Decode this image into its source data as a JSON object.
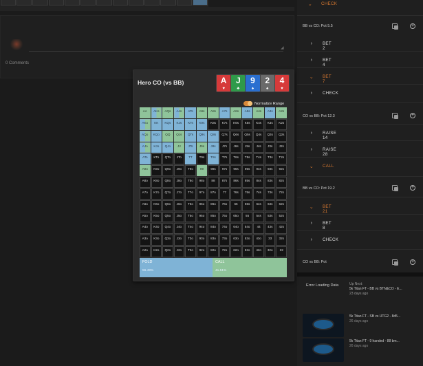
{
  "comments": {
    "count_label": "0 Comments"
  },
  "range": {
    "title": "Hero CO (vs BB)",
    "board": [
      {
        "rank": "A",
        "suit": "♥",
        "color": "#d63a3a"
      },
      {
        "rank": "J",
        "suit": "♣",
        "color": "#2f9a4a"
      },
      {
        "rank": "9",
        "suit": "♠",
        "color": "#2a6fd0"
      },
      {
        "rank": "2",
        "suit": "♠",
        "color": "#6a6a6a"
      },
      {
        "rank": "4",
        "suit": "♥",
        "color": "#d63a3a"
      }
    ],
    "normalize_label": "Normalize Range",
    "normalize_on": true,
    "legend_colors": {
      "fold": "#7fb3d6",
      "call": "#8fc49a"
    },
    "fold": {
      "label": "FOLD",
      "percent": "56.49%"
    },
    "call": {
      "label": "CALL",
      "percent": "41.51%"
    },
    "grid": [
      [
        "AA",
        "AKs",
        "AQs",
        "AJs",
        "ATs",
        "A9s",
        "A8s",
        "A7s",
        "A6s",
        "A5s",
        "A4s",
        "A3s",
        "A2s"
      ],
      [
        "AKo",
        "KK",
        "KQs",
        "KJs",
        "KTs",
        "K9s",
        "K8s",
        "K7s",
        "K6s",
        "K5s",
        "K4s",
        "K3s",
        "K2s"
      ],
      [
        "AQo",
        "KQo",
        "QQ",
        "QJs",
        "QTs",
        "Q9s",
        "Q8s",
        "Q7s",
        "Q6s",
        "Q5s",
        "Q4s",
        "Q3s",
        "Q2s"
      ],
      [
        "AJo",
        "KJo",
        "QJo",
        "JJ",
        "JTs",
        "J9s",
        "J8s",
        "J7s",
        "J6s",
        "J5s",
        "J4s",
        "J3s",
        "J2s"
      ],
      [
        "ATo",
        "KTo",
        "QTo",
        "JTo",
        "TT",
        "T9s",
        "T8s",
        "T7s",
        "T6s",
        "T5s",
        "T4s",
        "T3s",
        "T2s"
      ],
      [
        "A9o",
        "K9o",
        "Q9o",
        "J9o",
        "T9o",
        "99",
        "98s",
        "97s",
        "96s",
        "95s",
        "94s",
        "93s",
        "92s"
      ],
      [
        "A8o",
        "K8o",
        "Q8o",
        "J8o",
        "T8o",
        "98o",
        "88",
        "87s",
        "86s",
        "85s",
        "84s",
        "83s",
        "82s"
      ],
      [
        "A7o",
        "K7o",
        "Q7o",
        "J7o",
        "T7o",
        "97o",
        "87o",
        "77",
        "76s",
        "75s",
        "74s",
        "73s",
        "72s"
      ],
      [
        "A6o",
        "K6o",
        "Q6o",
        "J6o",
        "T6o",
        "96o",
        "86o",
        "76o",
        "66",
        "65s",
        "64s",
        "63s",
        "62s"
      ],
      [
        "A5o",
        "K5o",
        "Q5o",
        "J5o",
        "T5o",
        "95o",
        "85o",
        "75o",
        "65o",
        "55",
        "54s",
        "53s",
        "52s"
      ],
      [
        "A4o",
        "K4o",
        "Q4o",
        "J4o",
        "T4o",
        "94o",
        "84o",
        "74o",
        "64o",
        "54o",
        "44",
        "43s",
        "42s"
      ],
      [
        "A3o",
        "K3o",
        "Q3o",
        "J3o",
        "T3o",
        "93o",
        "83o",
        "73o",
        "63o",
        "53o",
        "43o",
        "33",
        "32s"
      ],
      [
        "A2o",
        "K2o",
        "Q2o",
        "J2o",
        "T2o",
        "92o",
        "82o",
        "72o",
        "62o",
        "52o",
        "42o",
        "32o",
        "22"
      ]
    ],
    "grid_actions": [
      [
        "c",
        "m",
        "c",
        "m",
        "f",
        "c",
        "c",
        "f",
        "c",
        "f",
        "c",
        "f",
        "c"
      ],
      [
        "m",
        "f",
        "f",
        "f",
        "f",
        "f",
        "n",
        "n",
        "n",
        "n",
        "n",
        "n",
        "n"
      ],
      [
        "m",
        "f",
        "c",
        "c",
        "f",
        "f",
        "f",
        "n",
        "n",
        "n",
        "n",
        "n",
        "n"
      ],
      [
        "m",
        "f",
        "f",
        "c",
        "f",
        "c",
        "f",
        "n",
        "n",
        "n",
        "n",
        "n",
        "n"
      ],
      [
        "f",
        "n",
        "n",
        "n",
        "f",
        "n",
        "f",
        "n",
        "n",
        "n",
        "n",
        "n",
        "n"
      ],
      [
        "c",
        "n",
        "n",
        "n",
        "n",
        "c",
        "n",
        "n",
        "n",
        "n",
        "n",
        "n",
        "n"
      ],
      [
        "n",
        "n",
        "n",
        "n",
        "n",
        "n",
        "n",
        "n",
        "n",
        "n",
        "n",
        "n",
        "n"
      ],
      [
        "n",
        "n",
        "n",
        "n",
        "n",
        "n",
        "n",
        "n",
        "n",
        "n",
        "n",
        "n",
        "n"
      ],
      [
        "n",
        "n",
        "n",
        "n",
        "n",
        "n",
        "n",
        "n",
        "n",
        "n",
        "n",
        "n",
        "n"
      ],
      [
        "n",
        "n",
        "n",
        "n",
        "n",
        "n",
        "n",
        "n",
        "n",
        "n",
        "n",
        "n",
        "n"
      ],
      [
        "n",
        "n",
        "n",
        "n",
        "n",
        "n",
        "n",
        "n",
        "n",
        "n",
        "n",
        "n",
        "n"
      ],
      [
        "n",
        "n",
        "n",
        "n",
        "n",
        "n",
        "n",
        "n",
        "n",
        "n",
        "n",
        "n",
        "n"
      ],
      [
        "n",
        "n",
        "n",
        "n",
        "n",
        "n",
        "n",
        "n",
        "n",
        "n",
        "n",
        "n",
        "n"
      ]
    ]
  },
  "actions": {
    "check_top": "CHECK",
    "header1": "BB vs CO: Pot 5.5",
    "bet2": "BET 2",
    "bet4": "BET 4",
    "bet7": "BET 7",
    "check1": "CHECK",
    "header2": "CO vs BB: Pot 12.3",
    "raise14": "RAISE 14",
    "raise28": "RAISE 28",
    "call": "CALL",
    "header3": "BB vs CO: Pot 19.2",
    "bet21": "BET 21",
    "bet8": "BET 8",
    "check2": "CHECK",
    "header4": "CO vs BB: Pot"
  },
  "sidebar": {
    "error_label": "Error Loading Data",
    "up_next_label": "Up Next:",
    "up_next_title": "5k Titan FT - BB vs BTN&CO - E...",
    "up_next_age": "23 days ago",
    "videos": [
      {
        "title": "5k Titan FT - SB vs UTG2 - 8d5...",
        "age": "26 days ago"
      },
      {
        "title": "5k Titan FT - 9 handed - 88 bm...",
        "age": "26 days ago"
      }
    ]
  }
}
